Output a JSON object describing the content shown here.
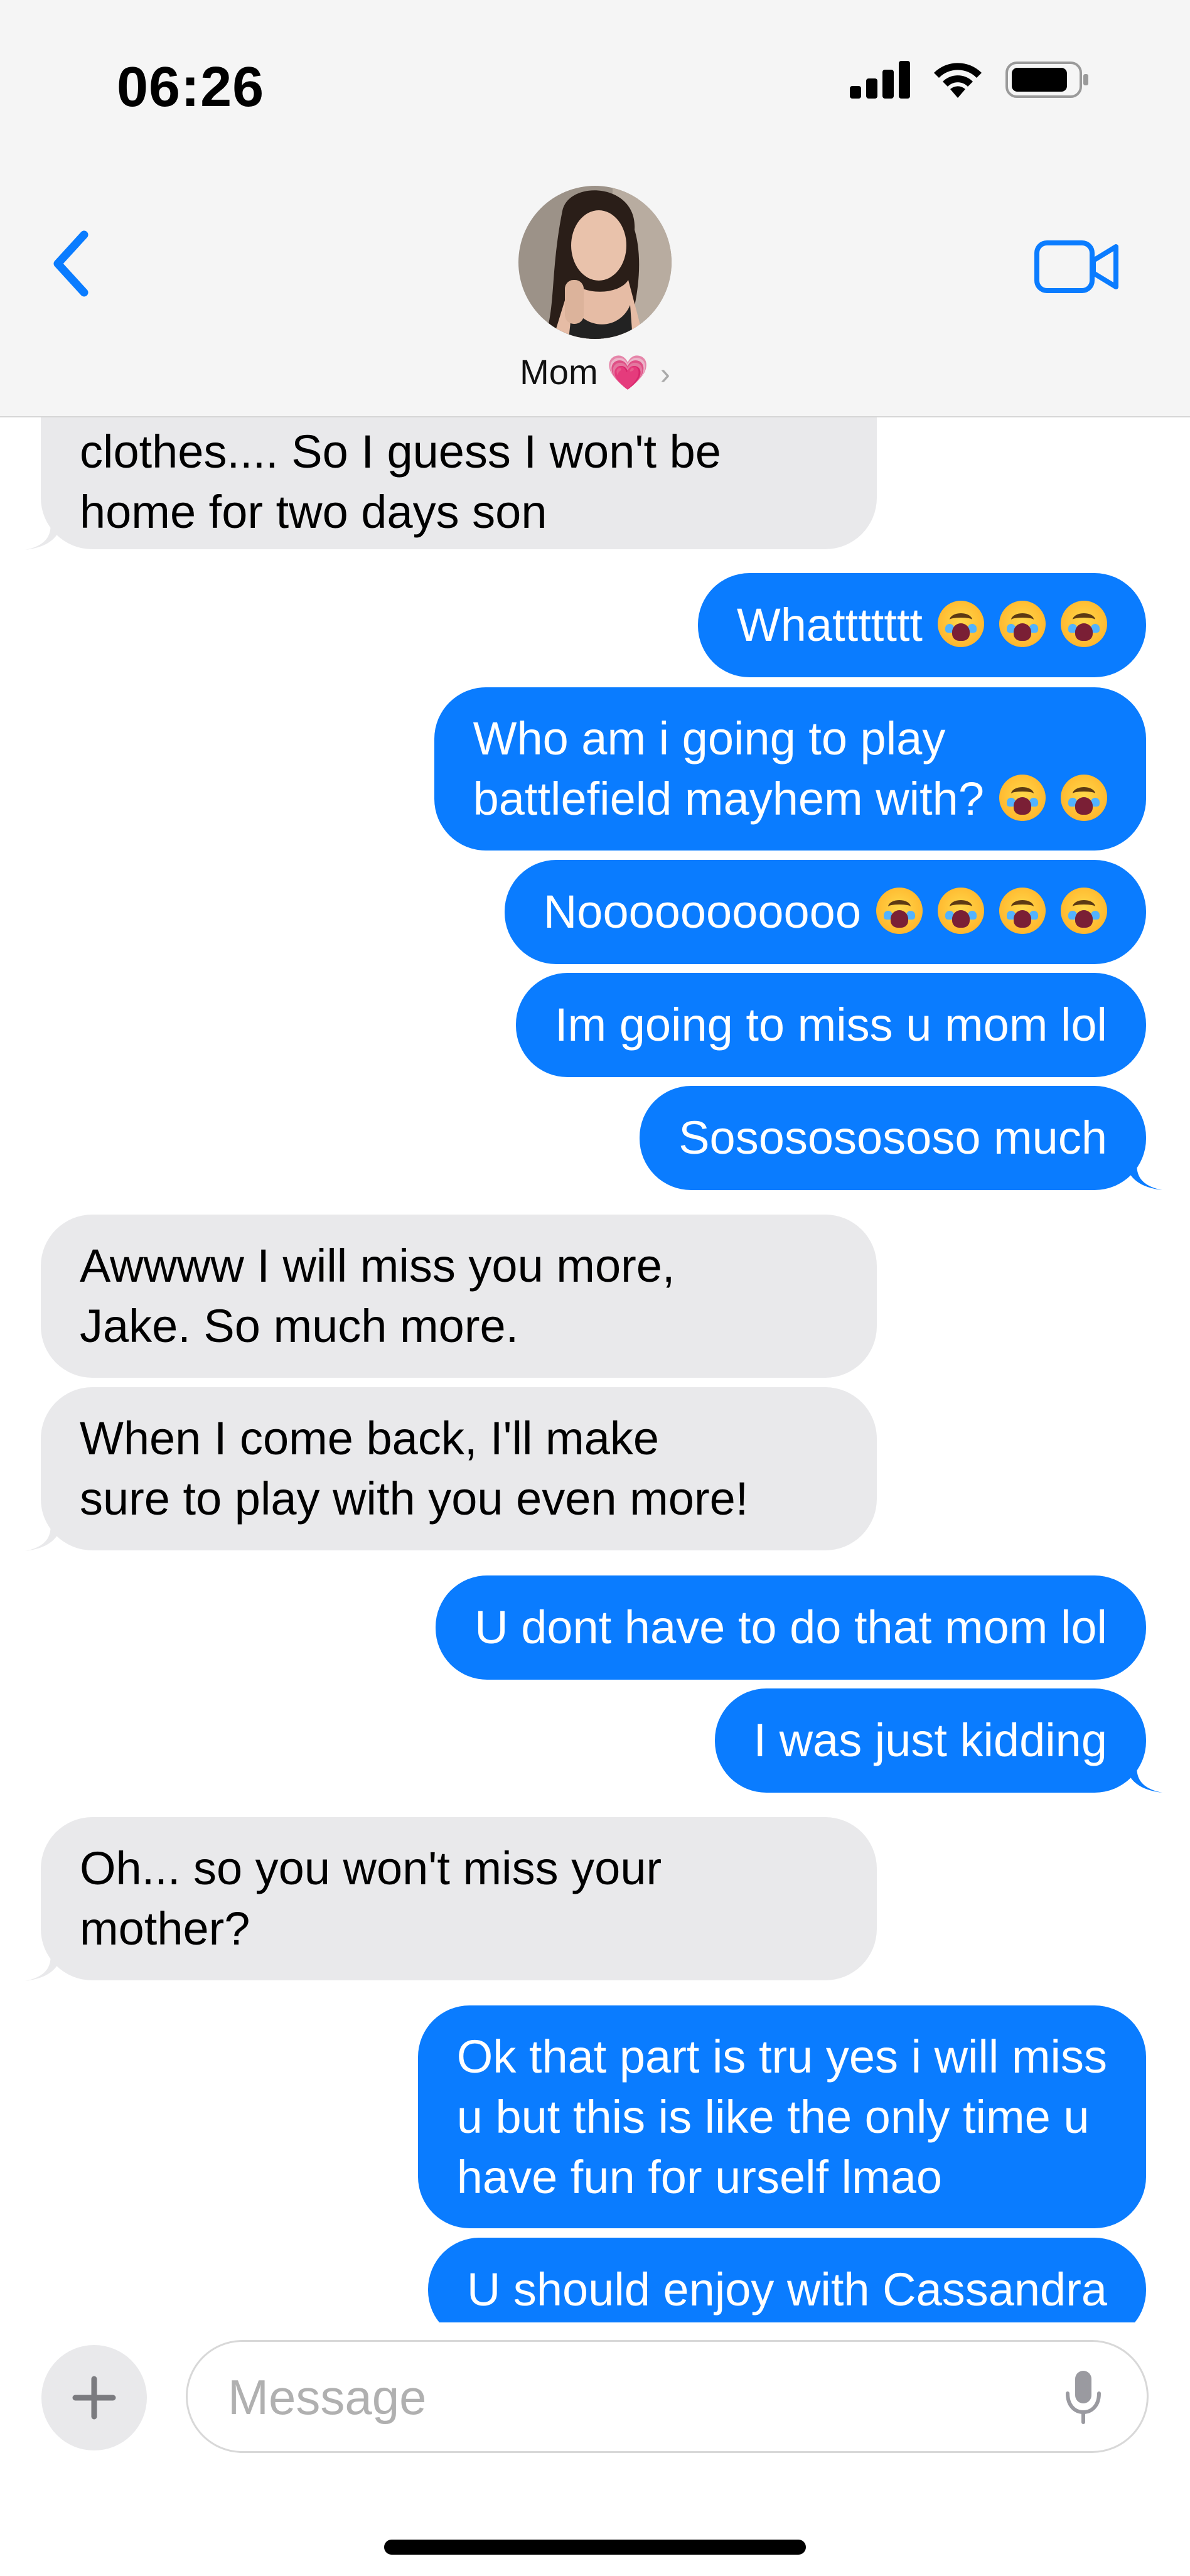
{
  "status_bar": {
    "time": "06:26"
  },
  "header": {
    "contact_name": "Mom",
    "contact_emoji": "💗",
    "chevron": "›"
  },
  "messages": [
    {
      "side": "in",
      "lines": [
        "clothes.... So I guess I won't be",
        "home for two days son"
      ]
    },
    {
      "side": "out",
      "lines": [
        "Whattttttt"
      ],
      "emoji": 3
    },
    {
      "side": "out",
      "lines": [
        "Who am i going to play",
        "battlefield mayhem with?"
      ],
      "emoji": 2
    },
    {
      "side": "out",
      "lines": [
        "Nooooooooooo"
      ],
      "emoji": 4
    },
    {
      "side": "out",
      "lines": [
        "Im going to miss u mom lol"
      ]
    },
    {
      "side": "out",
      "lines": [
        "Sosososososo much"
      ]
    },
    {
      "side": "in",
      "lines": [
        "Awwww I will miss you more,",
        "Jake. So much more."
      ]
    },
    {
      "side": "in",
      "lines": [
        "When I come back, I'll make",
        "sure to play with you even more!"
      ]
    },
    {
      "side": "out",
      "lines": [
        "U dont have to do that mom lol"
      ]
    },
    {
      "side": "out",
      "lines": [
        "I was just kidding"
      ]
    },
    {
      "side": "in",
      "lines": [
        "Oh... so you won't miss your",
        "mother?"
      ]
    },
    {
      "side": "out",
      "lines": [
        "Ok that part is tru yes i will miss",
        "u but this is like the only time u",
        "have fun for urself lmao"
      ]
    },
    {
      "side": "out",
      "lines": [
        "U should enjoy with Cassandra"
      ]
    }
  ],
  "composer": {
    "placeholder": "Message",
    "plus": "+"
  },
  "icons": {
    "back": "chevron-left-icon",
    "video": "video-camera-icon",
    "mic": "microphone-icon",
    "signal": "cellular-signal-icon",
    "wifi": "wifi-icon",
    "battery": "battery-icon"
  },
  "colors": {
    "outgoing": "#0a7cff",
    "incoming": "#e9e9eb",
    "accent": "#0a7cff"
  }
}
